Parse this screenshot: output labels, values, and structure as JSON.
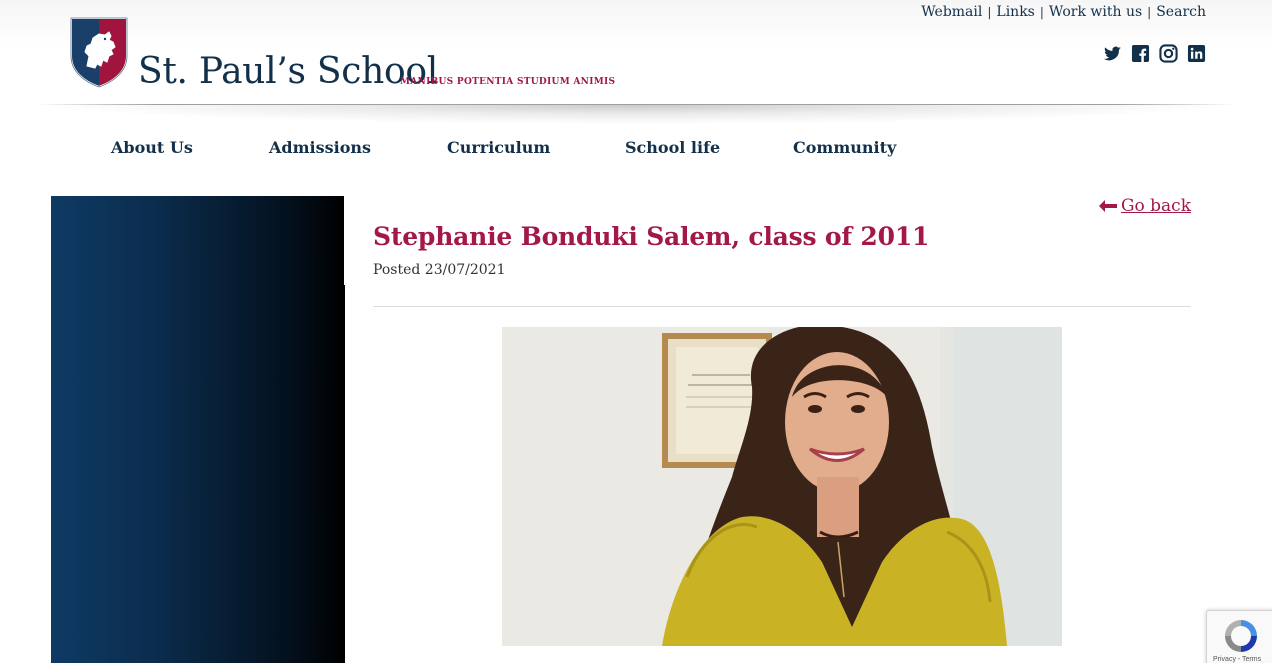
{
  "header": {
    "site_title": "St. Paul’s School",
    "motto": "MANIBUS POTENTIA STUDIUM ANIMIS",
    "util_links": [
      "Webmail",
      "Links",
      "Work with us",
      "Search"
    ],
    "social_icons": [
      "twitter-icon",
      "facebook-icon",
      "instagram-icon",
      "linkedin-icon"
    ]
  },
  "nav": {
    "items": [
      "About Us",
      "Admissions",
      "Curriculum",
      "School life",
      "Community"
    ]
  },
  "post": {
    "back_label": " Go back",
    "title": "Stephanie Bonduki Salem, class of 2011",
    "posted": "Posted 23/07/2021"
  },
  "recaptcha": {
    "footer_text": "Privacy - Terms"
  },
  "colors": {
    "navy": "#12304a",
    "accent": "#a3174a"
  }
}
